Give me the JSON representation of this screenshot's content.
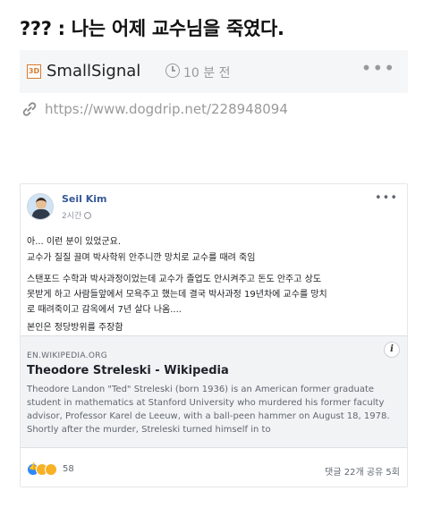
{
  "title": "??? : 나는 어제 교수님을 죽였다.",
  "top_card": {
    "logo_text": "3D",
    "site_name": "SmallSignal",
    "time": "10 분 전",
    "more": "•••"
  },
  "link": {
    "url": "https://www.dogdrip.net/228948094"
  },
  "post": {
    "author": "Seil Kim",
    "time": "2시간",
    "more": "•••",
    "lines": [
      "아... 이런 분이 있었군요.",
      "교수가 질질 끌며 박사학위 안주니깐 망치로 교수를 때려 죽임",
      "스탠포드 수학과 박사과정이었는데 교수가 졸업도 안시켜주고 돈도 안주고 상도",
      "못받게 하고 사람들앞에서 모욕주고 했는데 결국 박사과정 19년차에 교수를 망치",
      "로 때려죽이고 감옥에서 7년 살다 나옴....",
      "본인은 정당방위를 주장함"
    ],
    "preview": {
      "domain": "EN.WIKIPEDIA.ORG",
      "title": "Theodore Streleski - Wikipedia",
      "description": "Theodore Landon \"Ted\" Streleski (born 1936) is an American former graduate student in mathematics at Stanford University who murdered his former faculty advisor, Professor Karel de Leeuw, with a ball-peen hammer on August 18, 1978. Shortly after the murder, Streleski turned himself in to",
      "info_icon": "i"
    },
    "reaction_count": "58",
    "comments_shares": "댓글 22개  공유 5회"
  }
}
